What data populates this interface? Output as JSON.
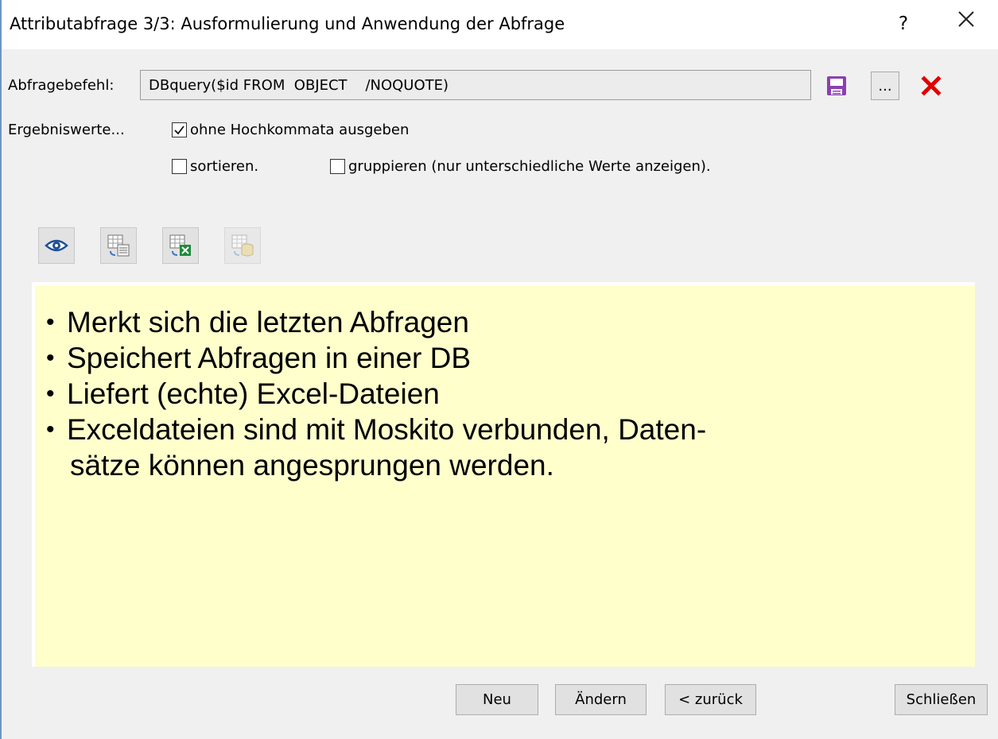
{
  "window": {
    "title": "Attributabfrage 3/3: Ausformulierung und Anwendung der Abfrage",
    "help_label": "?",
    "close_label": "×"
  },
  "query": {
    "label": "Abfragebefehl:",
    "command": "DBquery($id FROM  OBJECT    /NOQUOTE)",
    "browse_label": "..."
  },
  "options": {
    "group_label": "Ergebniswerte...",
    "no_quotes": {
      "label": "ohne Hochkommata ausgeben",
      "checked": true
    },
    "sort": {
      "label": "sortieren.",
      "checked": false
    },
    "group": {
      "label": "gruppieren (nur unterschiedliche Werte anzeigen).",
      "checked": false
    }
  },
  "toolbar": {
    "icons": [
      "view-eye-icon",
      "export-table-icon",
      "export-excel-icon",
      "export-database-icon"
    ]
  },
  "notes": [
    "Merkt sich die letzten Abfragen",
    "Speichert Abfragen in einer DB",
    "Liefert (echte) Excel-Dateien",
    "Exceldateien sind mit Moskito verbunden, Daten-",
    "sätze können angesprungen werden."
  ],
  "buttons": {
    "new": "Neu",
    "edit": "Ändern",
    "back": "< zurück",
    "close": "Schließen"
  },
  "colors": {
    "window_bg": "#f0f0f0",
    "note_bg": "#ffffcc",
    "save_icon": "#8c3fb3",
    "delete_icon": "#e00000"
  }
}
